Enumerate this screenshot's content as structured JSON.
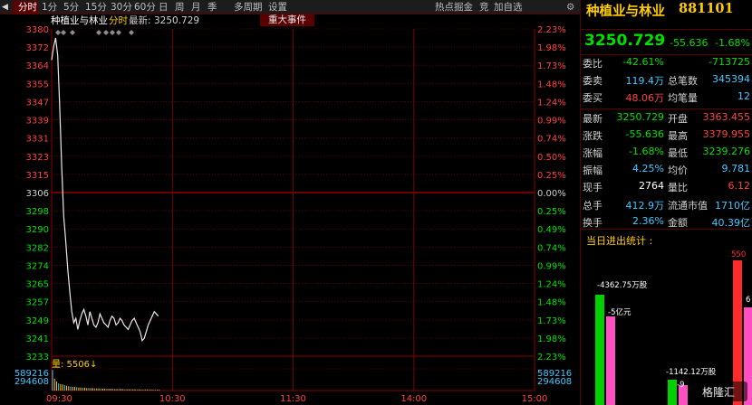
{
  "toolbar": {
    "arrow": "◀",
    "tabs": [
      "分时",
      "1分",
      "5分",
      "15分",
      "30分",
      "60分",
      "日",
      "周",
      "月",
      "季",
      "多周期",
      "设置"
    ],
    "right": [
      "热点掘金",
      "竞",
      "加自选",
      "⚙"
    ]
  },
  "info": {
    "name": "种植业与林业",
    "mode": "分时",
    "latest_label": "最新:",
    "latest_value": "3250.729",
    "event_button": "重大事件"
  },
  "chart_data": {
    "type": "line",
    "title": "种植业与林业 分时",
    "prev_close": 3306,
    "ylim": [
      3233,
      3380
    ],
    "y_ticks": [
      "3380",
      "3372",
      "3364",
      "3355",
      "3347",
      "3339",
      "3331",
      "3323",
      "3315",
      "3306",
      "3298",
      "3290",
      "3282",
      "3274",
      "3265",
      "3257",
      "3249",
      "3241",
      "3233"
    ],
    "pct_ticks": [
      "2.23%",
      "1.98%",
      "1.73%",
      "1.48%",
      "1.24%",
      "0.99%",
      "0.74%",
      "0.50%",
      "0.25%",
      "0.00%",
      "0.25%",
      "0.49%",
      "0.74%",
      "0.99%",
      "1.24%",
      "1.48%",
      "1.73%",
      "1.98%",
      "2.23%"
    ],
    "x_ticks": [
      "09:30",
      "10:30",
      "11:30",
      "14:00",
      "15:00"
    ],
    "total_minutes": 240,
    "series": [
      {
        "name": "指数",
        "x": [
          0,
          1,
          2,
          3,
          4,
          5,
          6,
          7,
          8,
          9,
          10,
          11,
          12,
          13,
          14,
          15,
          16,
          17,
          18,
          19,
          20,
          21,
          22,
          23,
          24,
          25,
          26,
          27,
          28,
          29,
          30,
          31,
          32,
          33,
          34,
          35,
          36,
          37,
          38,
          39,
          40,
          41,
          42,
          43,
          44,
          45,
          46,
          47,
          48,
          49,
          50,
          51,
          52,
          53
        ],
        "values": [
          3366,
          3372,
          3376,
          3368,
          3345,
          3318,
          3296,
          3285,
          3272,
          3262,
          3253,
          3248,
          3250,
          3245,
          3249,
          3252,
          3254,
          3251,
          3247,
          3253,
          3250,
          3247,
          3246,
          3248,
          3252,
          3250,
          3248,
          3247,
          3246,
          3249,
          3251,
          3250,
          3247,
          3248,
          3250,
          3249,
          3247,
          3246,
          3245,
          3247,
          3249,
          3250,
          3248,
          3246,
          3244,
          3240,
          3241,
          3244,
          3247,
          3249,
          3251,
          3253,
          3252,
          3251
        ]
      }
    ],
    "volume": {
      "label": "量",
      "value": "5506",
      "ticks": [
        "589216",
        "294608"
      ],
      "bars": [
        0.95,
        0.55,
        0.42,
        0.33,
        0.3,
        0.28,
        0.25,
        0.22,
        0.2,
        0.18,
        0.17,
        0.16,
        0.15,
        0.14,
        0.14,
        0.13,
        0.13,
        0.12,
        0.12,
        0.11,
        0.11,
        0.1,
        0.1,
        0.1,
        0.09,
        0.09,
        0.09,
        0.08,
        0.08,
        0.08,
        0.08,
        0.07,
        0.07,
        0.07,
        0.07,
        0.07,
        0.06,
        0.06,
        0.06,
        0.06,
        0.06,
        0.06,
        0.05,
        0.05,
        0.05,
        0.05,
        0.05,
        0.05,
        0.05,
        0.05,
        0.04,
        0.04,
        0.04,
        0.04
      ]
    }
  },
  "panel": {
    "title": "种植业与林业",
    "code": "881101",
    "price": "3250.729",
    "change": "-55.636",
    "pct": "-1.68%",
    "rows": [
      {
        "l1": "委比",
        "v1": "-42.61%",
        "c1": "#00e000",
        "l2": "",
        "v2": "-713725",
        "c2": "#00e000"
      },
      {
        "l1": "委卖",
        "v1": "119.4万",
        "c1": "#40c8ff",
        "l2": "总笔数",
        "v2": "345394",
        "c2": "#40c8ff"
      },
      {
        "l1": "委买",
        "v1": "48.06万",
        "c1": "#ff4040",
        "l2": "均笔量",
        "v2": "12",
        "c2": "#40c8ff"
      },
      {
        "l1": "最新",
        "v1": "3250.729",
        "c1": "#00e000",
        "l2": "开盘",
        "v2": "3363.455",
        "c2": "#ff4040"
      },
      {
        "l1": "涨跌",
        "v1": "-55.636",
        "c1": "#00e000",
        "l2": "最高",
        "v2": "3379.955",
        "c2": "#ff4040"
      },
      {
        "l1": "涨幅",
        "v1": "-1.68%",
        "c1": "#00e000",
        "l2": "最低",
        "v2": "3239.276",
        "c2": "#00e000"
      },
      {
        "l1": "振幅",
        "v1": "4.25%",
        "c1": "#40c8ff",
        "l2": "均价",
        "v2": "9.781",
        "c2": "#40c8ff"
      },
      {
        "l1": "现手",
        "v1": "2764",
        "c1": "#ffffff",
        "l2": "量比",
        "v2": "6.12",
        "c2": "#ff4040"
      },
      {
        "l1": "总手",
        "v1": "412.9万",
        "c1": "#40c8ff",
        "l2": "流通市值",
        "v2": "1710亿",
        "c2": "#40c8ff"
      },
      {
        "l1": "换手",
        "v1": "2.36%",
        "c1": "#40c8ff",
        "l2": "金额",
        "v2": "40.39亿",
        "c2": "#40c8ff"
      }
    ],
    "flow_title": "当日进出统计 :",
    "flow_labels": {
      "a": "-4362.75万股",
      "b": "-5亿元",
      "c": "-1142.12万股",
      "d": "-9",
      "e": "550",
      "f": "6"
    },
    "watermark": "格隆汇"
  }
}
